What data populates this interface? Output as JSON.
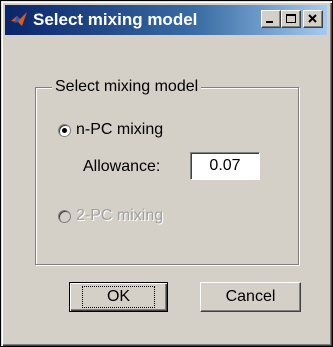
{
  "window": {
    "title": "Select mixing model",
    "icon": "matlab-icon"
  },
  "group": {
    "legend": "Select mixing model"
  },
  "options": [
    {
      "label": "n-PC mixing",
      "selected": true,
      "enabled": true
    },
    {
      "label": "2-PC mixing",
      "selected": false,
      "enabled": false
    }
  ],
  "allowance": {
    "label": "Allowance:",
    "value": "0.07"
  },
  "buttons": {
    "ok": "OK",
    "cancel": "Cancel"
  },
  "colors": {
    "titlebar_start": "#0a246a",
    "titlebar_end": "#a6caf0",
    "face": "#d4d0c8"
  }
}
